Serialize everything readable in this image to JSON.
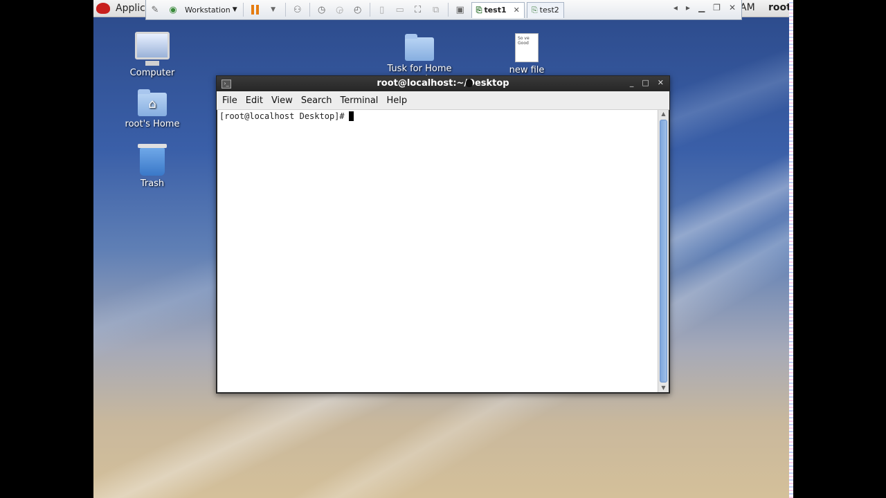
{
  "top_panel": {
    "apps_label": "Applic",
    "clock": "AM",
    "user": "root"
  },
  "vm_toolbar": {
    "workstation_label": "Workstation",
    "tabs": [
      {
        "label": "test1",
        "active": true
      },
      {
        "label": "test2",
        "active": false
      }
    ]
  },
  "desktop": {
    "icons": [
      {
        "label": "Computer"
      },
      {
        "label": "root's Home"
      },
      {
        "label": "Trash"
      },
      {
        "label": "Tusk for Home work"
      },
      {
        "label": "new file",
        "preview": "So ve Good"
      }
    ]
  },
  "terminal": {
    "title": "root@localhost:~/Desktop",
    "menu": [
      "File",
      "Edit",
      "View",
      "Search",
      "Terminal",
      "Help"
    ],
    "prompt": "[root@localhost Desktop]#"
  }
}
